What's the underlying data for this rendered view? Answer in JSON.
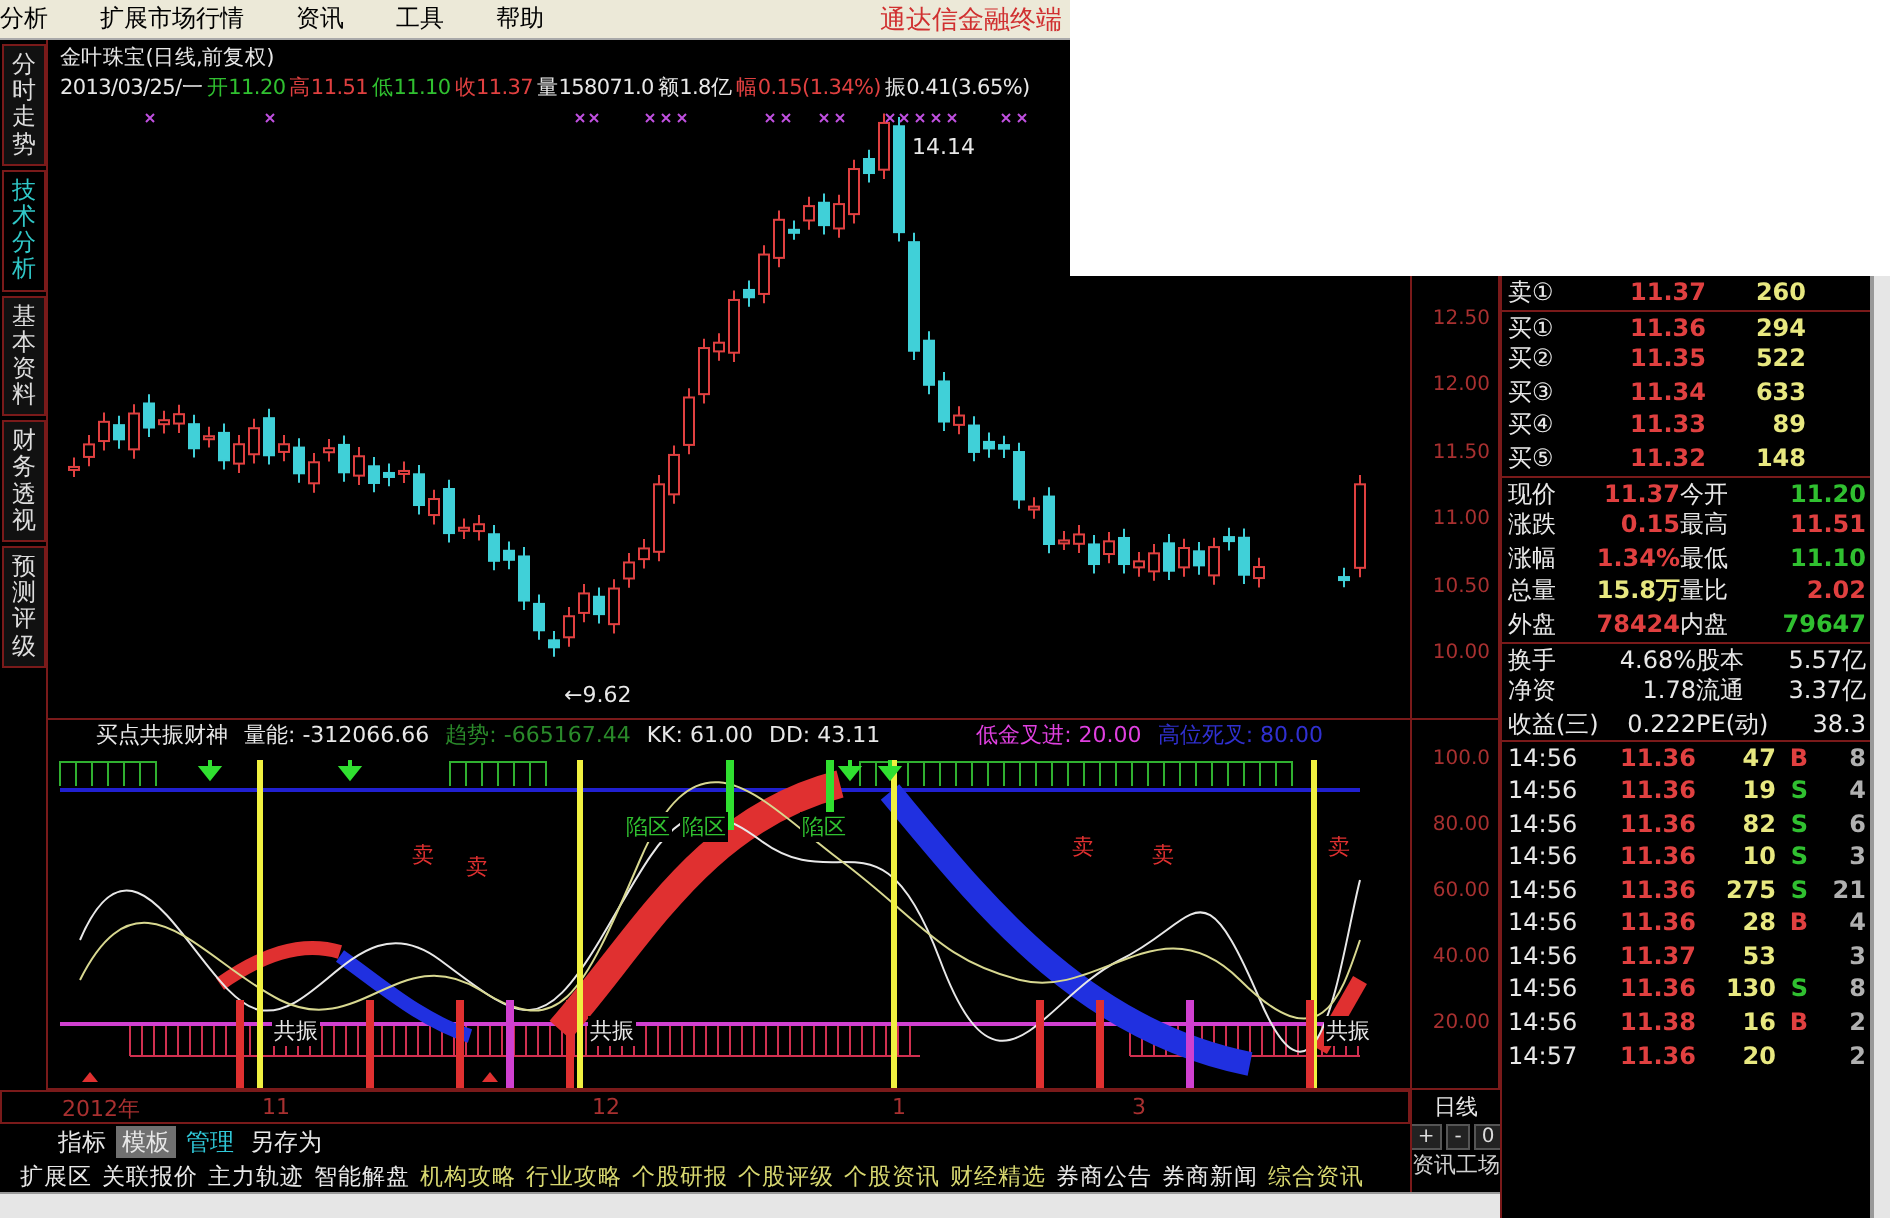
{
  "menu": {
    "items": [
      "分析",
      "扩展市场行情",
      "资讯",
      "工具",
      "帮助"
    ],
    "brand": "通达信金融终端"
  },
  "side_tabs": [
    {
      "label": "分时走势",
      "selected": false
    },
    {
      "label": "技术分析",
      "selected": true
    },
    {
      "label": "基本资料",
      "selected": false
    },
    {
      "label": "财务透视",
      "selected": false
    },
    {
      "label": "预测评级",
      "selected": false
    }
  ],
  "chart": {
    "title": "金叶珠宝(日线,前复权)",
    "date": "2013/03/25/一",
    "fields": [
      {
        "label": "开",
        "value": "11.20",
        "color": "#30c030"
      },
      {
        "label": "高",
        "value": "11.51",
        "color": "#e04040"
      },
      {
        "label": "低",
        "value": "11.10",
        "color": "#30c030"
      },
      {
        "label": "收",
        "value": "11.37",
        "color": "#e04040"
      },
      {
        "label": "量",
        "value": "158071.0",
        "color": "#e8e8e8"
      },
      {
        "label": "额",
        "value": "1.8亿",
        "color": "#e8e8e8"
      },
      {
        "label": "幅",
        "value": "0.15(1.34%)",
        "color": "#e04040"
      },
      {
        "label": "振",
        "value": "0.41(3.65%)",
        "color": "#e8e8e8"
      }
    ],
    "high_label": "14.14",
    "low_label": "←9.62",
    "price_ticks": [
      "12.50",
      "12.00",
      "11.50",
      "11.00",
      "10.50",
      "10.00"
    ]
  },
  "indicator": {
    "name": "买点共振财神",
    "readouts": [
      {
        "text": "量能: -312066.66",
        "color": "#e8e8e8"
      },
      {
        "text": "趋势: -665167.44",
        "color": "#2a8a2a"
      },
      {
        "text": "KK: 61.00",
        "color": "#e8e8e8"
      },
      {
        "text": "DD: 43.11",
        "color": "#e8e8e8"
      },
      {
        "text": "低金叉进: 20.00",
        "color": "#e040e0"
      },
      {
        "text": "高位死叉: 80.00",
        "color": "#3030d0"
      }
    ],
    "labels": [
      {
        "text": "卖",
        "color": "#e03030"
      },
      {
        "text": "卖",
        "color": "#e03030"
      },
      {
        "text": "陷区",
        "color": "#30c030"
      },
      {
        "text": "陷区",
        "color": "#30c030"
      },
      {
        "text": "陷区",
        "color": "#30c030"
      },
      {
        "text": "卖",
        "color": "#e03030"
      },
      {
        "text": "卖",
        "color": "#e03030"
      },
      {
        "text": "卖",
        "color": "#e03030"
      },
      {
        "text": "共振",
        "color": "#e8e8e8"
      },
      {
        "text": "共振",
        "color": "#e8e8e8"
      },
      {
        "text": "共振",
        "color": "#e8e8e8"
      }
    ],
    "ticks": [
      "100.0",
      "80.00",
      "60.00",
      "40.00",
      "20.00"
    ]
  },
  "quote": {
    "order_book": [
      {
        "label": "卖①",
        "price": "11.37",
        "volume": "260"
      },
      {
        "label": "买①",
        "price": "11.36",
        "volume": "294"
      },
      {
        "label": "买②",
        "price": "11.35",
        "volume": "522"
      },
      {
        "label": "买③",
        "price": "11.34",
        "volume": "633"
      },
      {
        "label": "买④",
        "price": "11.33",
        "volume": "89"
      },
      {
        "label": "买⑤",
        "price": "11.32",
        "volume": "148"
      }
    ],
    "stats": [
      {
        "label": "现价",
        "value": "11.37",
        "color": "#e04040"
      },
      {
        "label": "今开",
        "value": "11.20",
        "color": "#30c030"
      },
      {
        "label": "涨跌",
        "value": "0.15",
        "color": "#e04040"
      },
      {
        "label": "最高",
        "value": "11.51",
        "color": "#e04040"
      },
      {
        "label": "涨幅",
        "value": "1.34%",
        "color": "#e04040"
      },
      {
        "label": "最低",
        "value": "11.10",
        "color": "#30c030"
      },
      {
        "label": "总量",
        "value": "15.8万",
        "color": "#e8e880"
      },
      {
        "label": "量比",
        "value": "2.02",
        "color": "#e04040"
      },
      {
        "label": "外盘",
        "value": "78424",
        "color": "#e04040"
      },
      {
        "label": "内盘",
        "value": "79647",
        "color": "#30c030"
      }
    ],
    "fundamentals": [
      {
        "label": "换手",
        "value": "4.68%"
      },
      {
        "label": "股本",
        "value": "5.57亿"
      },
      {
        "label": "净资",
        "value": "1.78"
      },
      {
        "label": "流通",
        "value": "3.37亿"
      },
      {
        "label": "收益(三)",
        "value": "0.222"
      },
      {
        "label": "PE(动)",
        "value": "38.3"
      }
    ],
    "trades": [
      {
        "time": "14:56",
        "price": "11.36",
        "volume": "47",
        "side": "B",
        "kind": "buy",
        "count": "8"
      },
      {
        "time": "14:56",
        "price": "11.36",
        "volume": "19",
        "side": "S",
        "kind": "sell",
        "count": "4"
      },
      {
        "time": "14:56",
        "price": "11.36",
        "volume": "82",
        "side": "S",
        "kind": "sell",
        "count": "6"
      },
      {
        "time": "14:56",
        "price": "11.36",
        "volume": "10",
        "side": "S",
        "kind": "sell",
        "count": "3"
      },
      {
        "time": "14:56",
        "price": "11.36",
        "volume": "275",
        "side": "S",
        "kind": "sell",
        "count": "21"
      },
      {
        "time": "14:56",
        "price": "11.36",
        "volume": "28",
        "side": "B",
        "kind": "buy",
        "count": "4"
      },
      {
        "time": "14:56",
        "price": "11.37",
        "volume": "53",
        "kind": "none",
        "count": "3"
      },
      {
        "time": "14:56",
        "price": "11.36",
        "volume": "130",
        "side": "S",
        "kind": "sell",
        "count": "8"
      },
      {
        "time": "14:56",
        "price": "11.38",
        "volume": "16",
        "side": "B",
        "kind": "buy",
        "count": "2"
      },
      {
        "time": "14:57",
        "price": "11.36",
        "volume": "20",
        "kind": "none",
        "count": "2"
      }
    ]
  },
  "time_axis": [
    "2012年",
    "11",
    "12",
    "1",
    "3"
  ],
  "period": "日线",
  "zoom_buttons": [
    "+",
    "-",
    "0"
  ],
  "formula_tabs": [
    {
      "label": "指标",
      "selected": false
    },
    {
      "label": "模板",
      "selected": true
    },
    {
      "label": "管理",
      "selected": false
    },
    {
      "label": "另存为",
      "selected": false
    }
  ],
  "info_tabs": [
    {
      "label": "扩展区",
      "color": "#e8e8e8"
    },
    {
      "label": "关联报价",
      "color": "#e8e8e8"
    },
    {
      "label": "主力轨迹",
      "color": "#e8e8e8"
    },
    {
      "label": "智能解盘",
      "color": "#e8e8e8"
    },
    {
      "label": "机构攻略",
      "color": "#d8d870"
    },
    {
      "label": "行业攻略",
      "color": "#d8d870"
    },
    {
      "label": "个股研报",
      "color": "#d8d870"
    },
    {
      "label": "个股评级",
      "color": "#d8d870"
    },
    {
      "label": "个股资讯",
      "color": "#d8d870"
    },
    {
      "label": "财经精选",
      "color": "#d8d870"
    },
    {
      "label": "券商公告",
      "color": "#e8e8e8"
    },
    {
      "label": "券商新闻",
      "color": "#e8e8e8"
    },
    {
      "label": "综合资讯",
      "color": "#d8d870"
    }
  ],
  "info_side": "资讯工场"
}
